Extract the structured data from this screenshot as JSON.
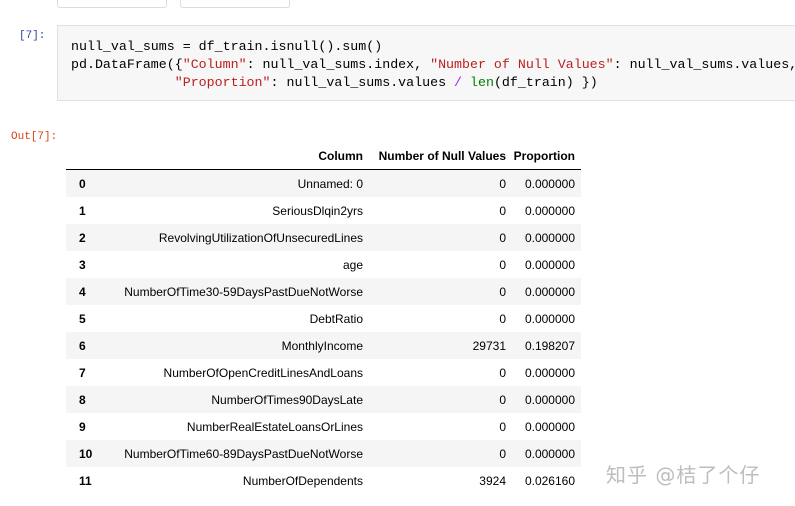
{
  "in_prompt": "[7]:",
  "out_prompt": "Out[7]:",
  "code": {
    "l1": "null_val_sums = df_train.isnull().sum()",
    "l2_pre": "pd.DataFrame({",
    "l2_s1": "\"Column\"",
    "l2_mid": ": null_val_sums.index, ",
    "l2_s2": "\"Number of Null Values\"",
    "l2_post": ": null_val_sums.values,",
    "l3_pad": "             ",
    "l3_s": "\"Proportion\"",
    "l3_mid": ": null_val_sums.values ",
    "l3_op": "/",
    "l3_sp": " ",
    "l3_fn": "len",
    "l3_post": "(df_train) })"
  },
  "table": {
    "headers": [
      "Column",
      "Number of Null Values",
      "Proportion"
    ],
    "rows": [
      {
        "index": "0",
        "column": "Unnamed: 0",
        "nulls": "0",
        "proportion": "0.000000"
      },
      {
        "index": "1",
        "column": "SeriousDlqin2yrs",
        "nulls": "0",
        "proportion": "0.000000"
      },
      {
        "index": "2",
        "column": "RevolvingUtilizationOfUnsecuredLines",
        "nulls": "0",
        "proportion": "0.000000"
      },
      {
        "index": "3",
        "column": "age",
        "nulls": "0",
        "proportion": "0.000000"
      },
      {
        "index": "4",
        "column": "NumberOfTime30-59DaysPastDueNotWorse",
        "nulls": "0",
        "proportion": "0.000000"
      },
      {
        "index": "5",
        "column": "DebtRatio",
        "nulls": "0",
        "proportion": "0.000000"
      },
      {
        "index": "6",
        "column": "MonthlyIncome",
        "nulls": "29731",
        "proportion": "0.198207"
      },
      {
        "index": "7",
        "column": "NumberOfOpenCreditLinesAndLoans",
        "nulls": "0",
        "proportion": "0.000000"
      },
      {
        "index": "8",
        "column": "NumberOfTimes90DaysLate",
        "nulls": "0",
        "proportion": "0.000000"
      },
      {
        "index": "9",
        "column": "NumberRealEstateLoansOrLines",
        "nulls": "0",
        "proportion": "0.000000"
      },
      {
        "index": "10",
        "column": "NumberOfTime60-89DaysPastDueNotWorse",
        "nulls": "0",
        "proportion": "0.000000"
      },
      {
        "index": "11",
        "column": "NumberOfDependents",
        "nulls": "3924",
        "proportion": "0.026160"
      }
    ]
  },
  "watermark": "知乎 @桔了个仔"
}
